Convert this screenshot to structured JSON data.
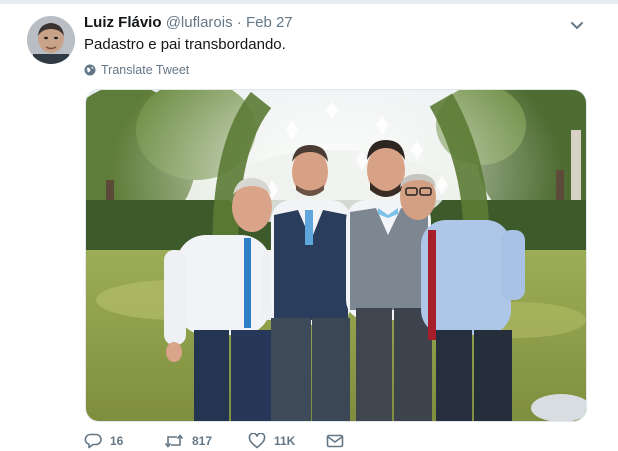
{
  "tweet": {
    "author_name": "Luiz Flávio",
    "handle": "@luflarois",
    "separator": "·",
    "date": "Feb 27",
    "text": "Padastro e pai transbordando.",
    "translate_label": "Translate Tweet"
  },
  "actions": {
    "reply_count": "16",
    "retweet_count": "817",
    "like_count": "11K"
  },
  "icons": {
    "avatar": "avatar",
    "menu": "chevron-down-icon",
    "translate": "globe-icon",
    "reply": "reply-icon",
    "retweet": "retweet-icon",
    "like": "heart-icon",
    "dm": "envelope-icon"
  },
  "colors": {
    "text": "#14171a",
    "secondary": "#657786",
    "border": "#e1e8ed"
  }
}
